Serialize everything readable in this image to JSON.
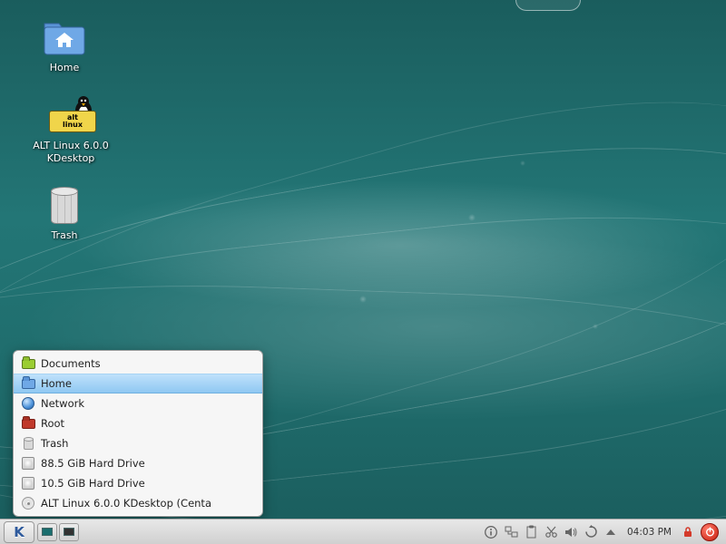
{
  "desktop_icons": {
    "home": {
      "label": "Home"
    },
    "alt_launcher": {
      "label": "ALT Linux 6.0.0 KDesktop",
      "badge_line1": "alt",
      "badge_line2": "linux"
    },
    "trash": {
      "label": "Trash"
    }
  },
  "places_menu": {
    "items": [
      {
        "label": "Documents",
        "icon": "folder-green",
        "selected": false
      },
      {
        "label": "Home",
        "icon": "folder-blue",
        "selected": true
      },
      {
        "label": "Network",
        "icon": "globe",
        "selected": false
      },
      {
        "label": "Root",
        "icon": "folder-red",
        "selected": false
      },
      {
        "label": "Trash",
        "icon": "trash",
        "selected": false
      },
      {
        "label": "88.5 GiB Hard Drive",
        "icon": "hdd",
        "selected": false
      },
      {
        "label": "10.5 GiB Hard Drive",
        "icon": "hdd",
        "selected": false
      },
      {
        "label": "ALT Linux 6.0.0 KDesktop (Centa",
        "icon": "cd",
        "selected": false
      }
    ]
  },
  "panel": {
    "clock": "04:03 PM"
  },
  "colors": {
    "wallpaper_teal": "#1a6e6e",
    "selection_blue": "#8fc8f2",
    "power_red": "#c81e0e"
  }
}
